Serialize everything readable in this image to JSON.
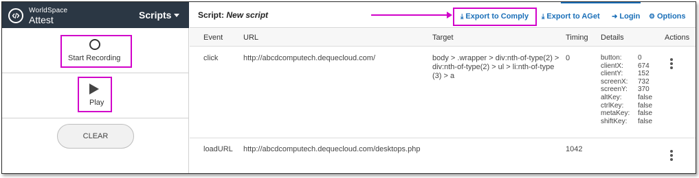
{
  "brand": {
    "line1": "WorldSpace",
    "line2": "Attest"
  },
  "sidebar": {
    "scripts_label": "Scripts",
    "start_recording_label": "Start Recording",
    "play_label": "Play",
    "clear_label": "CLEAR"
  },
  "header": {
    "script_prefix": "Script:",
    "script_name": "New script",
    "export_comply_label": "Export to Comply",
    "export_aget_label": "Export to AGet",
    "login_label": "Login",
    "options_label": "Options"
  },
  "table": {
    "columns": [
      "Event",
      "URL",
      "Target",
      "Timing",
      "Details",
      "Actions"
    ],
    "rows": [
      {
        "event": "click",
        "url": "http://abcdcomputech.dequecloud.com/",
        "target": "body > .wrapper > div:nth-of-type(2) > div:nth-of-type(2) > ul > li:nth-of-type (3) > a",
        "timing": "0",
        "details": [
          {
            "key": "button:",
            "value": "0"
          },
          {
            "key": "clientX:",
            "value": "674"
          },
          {
            "key": "clientY:",
            "value": "152"
          },
          {
            "key": "screenX:",
            "value": "732"
          },
          {
            "key": "screenY:",
            "value": "370"
          },
          {
            "key": "altKey:",
            "value": "false"
          },
          {
            "key": "ctrlKey:",
            "value": "false"
          },
          {
            "key": "metaKey:",
            "value": "false"
          },
          {
            "key": "shiftKey:",
            "value": "false"
          }
        ]
      },
      {
        "event": "loadURL",
        "url": "http://abcdcomputech.dequecloud.com/desktops.php",
        "target": "",
        "timing": "1042",
        "details": []
      }
    ]
  },
  "colors": {
    "brand_bar": "#2b3744",
    "link": "#1a6fb8",
    "highlight": "#d100c9"
  }
}
